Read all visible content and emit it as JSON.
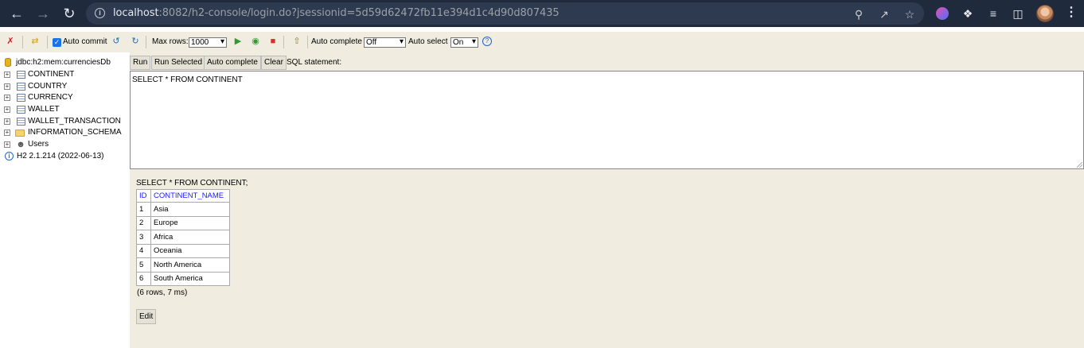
{
  "browser": {
    "url_host": "localhost",
    "url_rest": ":8082/h2-console/login.do?jsessionid=5d59d62472fb11e394d1c4d90d807435"
  },
  "toolbar": {
    "auto_commit_label": "Auto commit",
    "auto_commit_checked": true,
    "max_rows_label": "Max rows:",
    "max_rows_value": "1000",
    "auto_complete_label": "Auto complete",
    "auto_complete_value": "Off",
    "auto_select_label": "Auto select",
    "auto_select_value": "On",
    "help_glyph": "?"
  },
  "tree": {
    "connection": "jdbc:h2:mem:currenciesDb",
    "tables": [
      "CONTINENT",
      "COUNTRY",
      "CURRENCY",
      "WALLET",
      "WALLET_TRANSACTION"
    ],
    "schema": "INFORMATION_SCHEMA",
    "users": "Users",
    "version": "H2 2.1.214 (2022-06-13)"
  },
  "actions": {
    "run": "Run",
    "run_selected": "Run Selected",
    "auto_complete": "Auto complete",
    "clear": "Clear",
    "sql_label": "SQL statement:"
  },
  "editor": {
    "text": "SELECT * FROM CONTINENT"
  },
  "result": {
    "query": "SELECT * FROM CONTINENT;",
    "columns": [
      "ID",
      "CONTINENT_NAME"
    ],
    "rows": [
      [
        "1",
        "Asia"
      ],
      [
        "2",
        "Europe"
      ],
      [
        "3",
        "Africa"
      ],
      [
        "4",
        "Oceania"
      ],
      [
        "5",
        "North America"
      ],
      [
        "6",
        "South America"
      ]
    ],
    "row_count": "(6 rows, 7 ms)",
    "edit": "Edit"
  }
}
